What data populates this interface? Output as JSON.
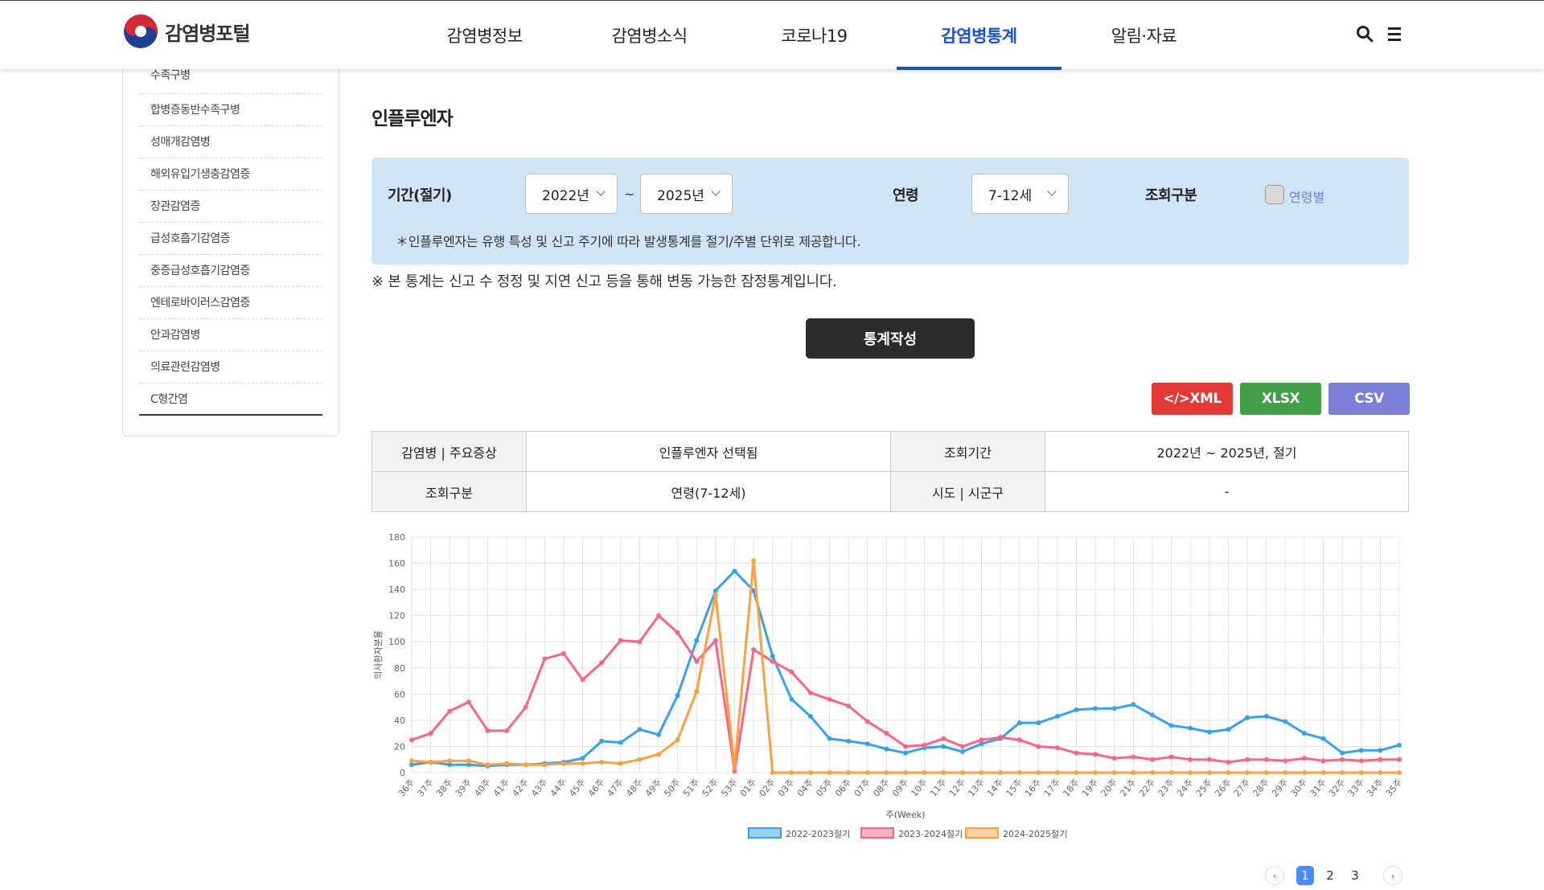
{
  "header": {
    "logo_text": "감염병포털",
    "nav": [
      {
        "label": "감염병정보"
      },
      {
        "label": "감염병소식"
      },
      {
        "label": "코로나19"
      },
      {
        "label": "감염병통계",
        "active": true
      },
      {
        "label": "알림·자료"
      }
    ],
    "icons": [
      "search-icon",
      "menu-icon"
    ]
  },
  "sidebar": {
    "items": [
      {
        "label": "수족구병"
      },
      {
        "label": "합병증동반수족구병"
      },
      {
        "label": "성매개감염병"
      },
      {
        "label": "해외유입기생충감염증"
      },
      {
        "label": "장관감염증"
      },
      {
        "label": "급성호흡기감염증"
      },
      {
        "label": "중증급성호흡기감염증"
      },
      {
        "label": "엔테로바이러스감염증"
      },
      {
        "label": "안과감염병"
      },
      {
        "label": "의료관련감염병"
      },
      {
        "label": "C형간염"
      }
    ]
  },
  "main": {
    "title": "인플루엔자",
    "filter": {
      "period_label": "기간(절기)",
      "start_year": "2022년",
      "tilde": "~",
      "end_year": "2025년",
      "age_label": "연령",
      "age_value": "7-12세",
      "query_label": "조회구분",
      "checkbox_label": "연령별",
      "note": "＊인플루엔자는 유행 특성 및 신고 주기에 따라 발생통계를 절기/주별 단위로 제공합니다."
    },
    "notice": "※ 본 통계는 신고 수 정정 및 지연 신고 등을 통해 변동 가능한 잠정통계입니다.",
    "make_button": "통계작성",
    "downloads": {
      "xml": "</>XML",
      "xlsx": "XLSX",
      "csv": "CSV"
    },
    "download_colors": {
      "xml": "#e53935",
      "xlsx": "#43a047",
      "csv": "#7b7fd6"
    },
    "info_table": {
      "r1": {
        "h1": "감염병 | 주요증상",
        "v1": "인플루엔자 선택됨",
        "h2": "조회기간",
        "v2": "2022년 ~ 2025년, 절기"
      },
      "r2": {
        "h1": "조회구분",
        "v1": "연령(7-12세)",
        "h2": "시도 | 시군구",
        "v2": "-"
      }
    },
    "pagination": {
      "prev": "‹",
      "pages": [
        "1",
        "2",
        "3"
      ],
      "current": "1",
      "next": "›"
    }
  },
  "chart_data": {
    "type": "line",
    "xlabel": "주(Week)",
    "ylabel": "의사환자분율",
    "ylim": [
      0,
      180
    ],
    "yticks": [
      0,
      20,
      40,
      60,
      80,
      100,
      120,
      140,
      160,
      180
    ],
    "grid": true,
    "legend_position": "bottom",
    "categories": [
      "36주",
      "37주",
      "38주",
      "39주",
      "40주",
      "41주",
      "42주",
      "43주",
      "44주",
      "45주",
      "46주",
      "47주",
      "48주",
      "49주",
      "50주",
      "51주",
      "52주",
      "53주",
      "01주",
      "02주",
      "03주",
      "04주",
      "05주",
      "06주",
      "07주",
      "08주",
      "09주",
      "10주",
      "11주",
      "12주",
      "13주",
      "14주",
      "15주",
      "16주",
      "17주",
      "18주",
      "19주",
      "20주",
      "21주",
      "22주",
      "23주",
      "24주",
      "25주",
      "26주",
      "27주",
      "28주",
      "29주",
      "30주",
      "31주",
      "32주",
      "33주",
      "34주",
      "35주"
    ],
    "series": [
      {
        "name": "2022-2023절기",
        "color": "#36a2eb",
        "values": [
          6,
          8,
          6,
          6,
          5,
          6,
          6,
          7,
          8,
          11,
          24,
          23,
          33,
          29,
          59,
          101,
          139,
          154,
          139,
          89,
          56,
          43,
          26,
          24,
          22,
          18,
          15,
          19,
          20,
          16,
          22,
          26,
          38,
          38,
          43,
          48,
          49,
          49,
          52,
          44,
          36,
          34,
          31,
          33,
          42,
          43,
          39,
          30,
          26,
          15,
          17,
          17,
          21
        ]
      },
      {
        "name": "2023-2024절기",
        "color": "#ff6384",
        "values": [
          25,
          30,
          47,
          54,
          32,
          32,
          50,
          87,
          91,
          71,
          84,
          101,
          100,
          120,
          107,
          85,
          101,
          1,
          94,
          85,
          77,
          61,
          56,
          51,
          39,
          30,
          20,
          21,
          26,
          20,
          25,
          27,
          25,
          20,
          19,
          15,
          14,
          11,
          12,
          10,
          12,
          10,
          10,
          8,
          10,
          10,
          9,
          11,
          9,
          10,
          9,
          10,
          10
        ]
      },
      {
        "name": "2024-2025절기",
        "color": "#ff9f40",
        "values": [
          9,
          8,
          9,
          9,
          6,
          7,
          6,
          6,
          7,
          7,
          8,
          7,
          10,
          14,
          25,
          62,
          136,
          4,
          162,
          0,
          0,
          0,
          0,
          0,
          0,
          0,
          0,
          0,
          0,
          0,
          0,
          0,
          0,
          0,
          0,
          0,
          0,
          0,
          0,
          0,
          0,
          0,
          0,
          0,
          0,
          0,
          0,
          0,
          0,
          0,
          0,
          0,
          0
        ]
      }
    ]
  }
}
